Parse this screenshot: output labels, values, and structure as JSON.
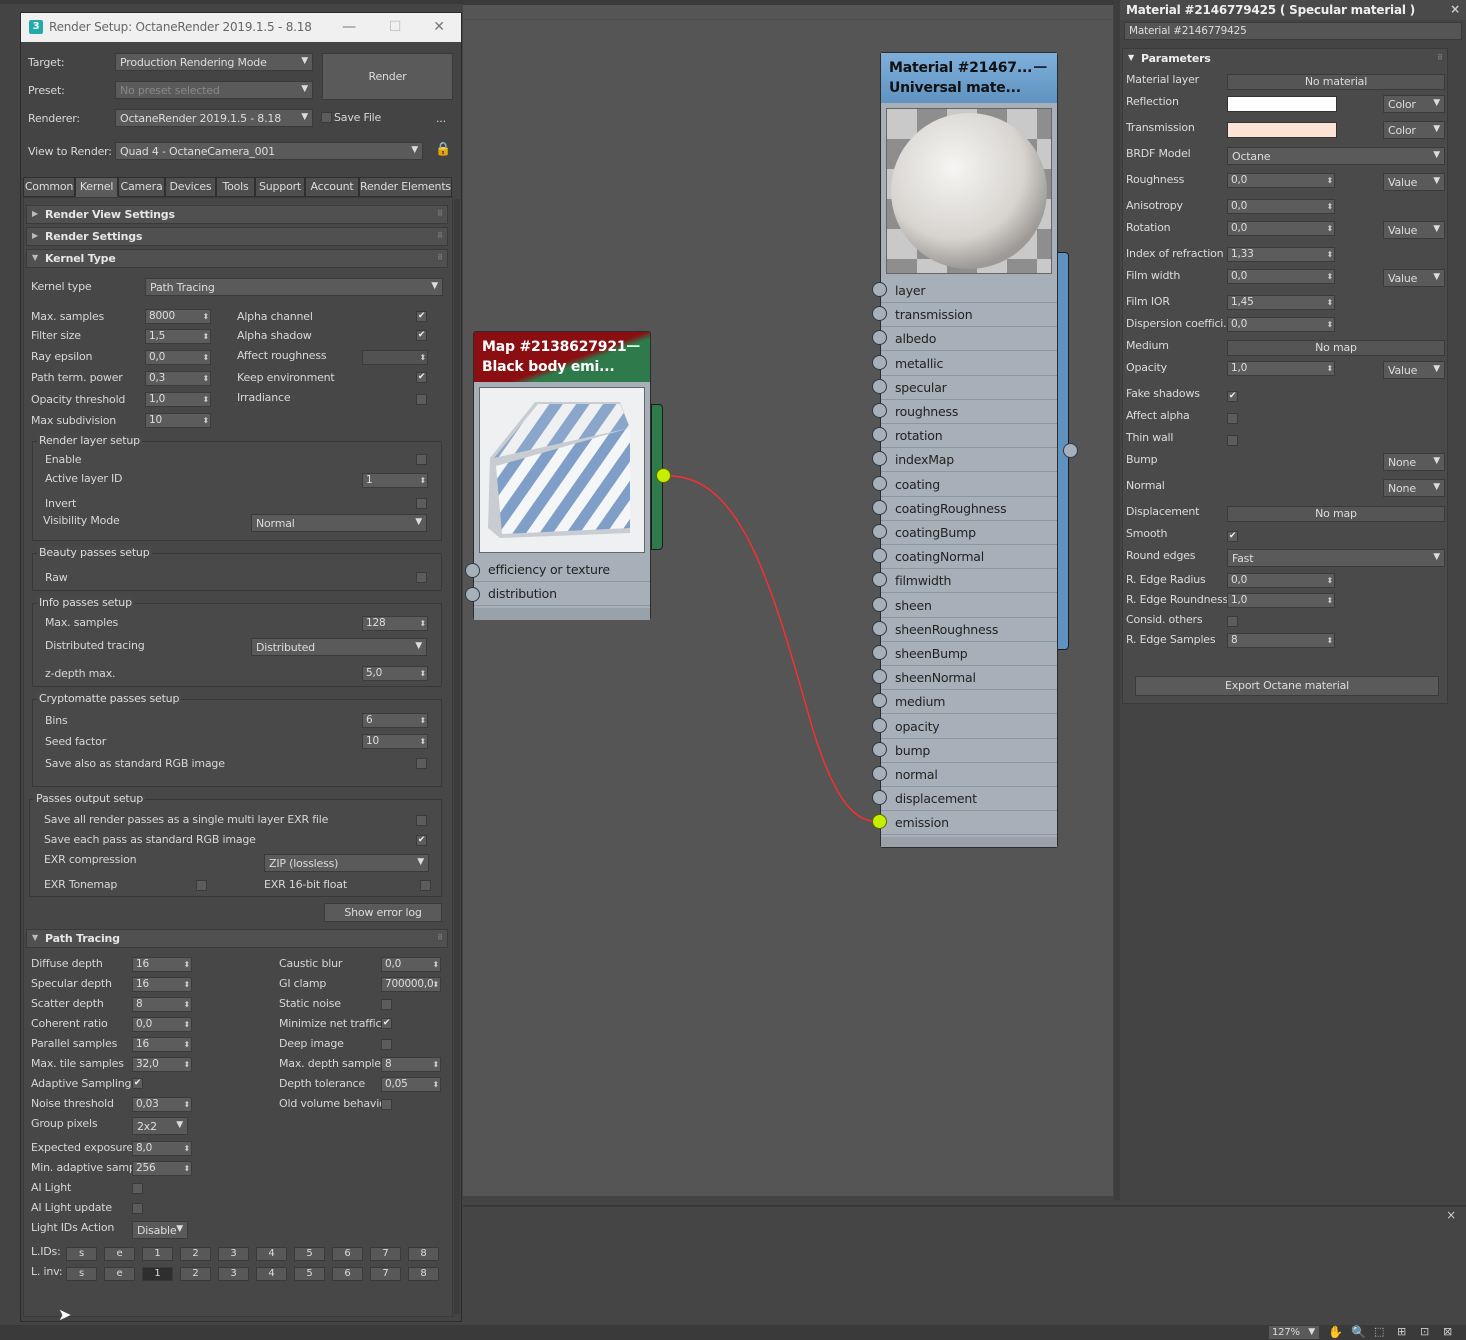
{
  "render_setup": {
    "title": "Render Setup: OctaneRender 2019.1.5 - 8.18",
    "target_label": "Target:",
    "target_value": "Production Rendering Mode",
    "preset_label": "Preset:",
    "preset_value": "No preset selected",
    "renderer_label": "Renderer:",
    "renderer_value": "OctaneRender 2019.1.5 - 8.18",
    "save_file_label": "Save File",
    "dots": "...",
    "view_label": "View to Render:",
    "view_value": "Quad 4 - OctaneCamera_001",
    "render_button": "Render",
    "tabs": [
      "Common",
      "Kernel",
      "Camera",
      "Devices",
      "Tools",
      "Support",
      "Account",
      "Render Elements"
    ],
    "rollouts": {
      "render_view": "Render View Settings",
      "render_settings": "Render Settings",
      "kernel_type": "Kernel Type",
      "path_tracing": "Path Tracing"
    },
    "kernel": {
      "kernel_type_label": "Kernel type",
      "kernel_type_value": "Path Tracing",
      "max_samples_label": "Max. samples",
      "max_samples": "8000",
      "filter_size_label": "Filter size",
      "filter_size": "1,5",
      "ray_epsilon_label": "Ray epsilon",
      "ray_epsilon": "0,0",
      "path_term_label": "Path term. power",
      "path_term": "0,3",
      "opacity_thr_label": "Opacity threshold",
      "opacity_thr": "1,0",
      "max_subdiv_label": "Max subdivision",
      "max_subdiv": "10",
      "alpha_channel": "Alpha channel",
      "alpha_shadow": "Alpha shadow",
      "affect_roughness": "Affect roughness",
      "keep_env": "Keep environment",
      "irradiance": "Irradiance"
    },
    "render_layer": {
      "title": "Render layer setup",
      "enable": "Enable",
      "active_layer_label": "Active layer ID",
      "active_layer": "1",
      "invert": "Invert",
      "visibility_label": "Visibility Mode",
      "visibility_value": "Normal"
    },
    "beauty": {
      "title": "Beauty passes setup",
      "raw": "Raw"
    },
    "info": {
      "title": "Info passes setup",
      "max_samples_label": "Max. samples",
      "max_samples": "128",
      "dist_label": "Distributed tracing",
      "dist_value": "Distributed",
      "zdepth_label": "z-depth max.",
      "zdepth": "5,0"
    },
    "crypto": {
      "title": "Cryptomatte passes setup",
      "bins_label": "Bins",
      "bins": "6",
      "seed_label": "Seed factor",
      "seed": "10",
      "save_rgb": "Save also as standard RGB image"
    },
    "passes_output": {
      "title": "Passes output setup",
      "save_all": "Save all render passes as a single multi layer EXR file",
      "save_each": "Save each pass as standard RGB image",
      "exr_comp_label": "EXR compression",
      "exr_comp_value": "ZIP (lossless)",
      "exr_tonemap": "EXR Tonemap",
      "exr_16bit": "EXR 16-bit float"
    },
    "show_error_log": "Show error log",
    "pt": {
      "diffuse_label": "Diffuse depth",
      "diffuse": "16",
      "specular_label": "Specular depth",
      "specular": "16",
      "scatter_label": "Scatter depth",
      "scatter": "8",
      "coherent_label": "Coherent ratio",
      "coherent": "0,0",
      "parallel_label": "Parallel samples",
      "parallel": "16",
      "tile_label": "Max. tile samples",
      "tile": "32,0",
      "adaptive_label": "Adaptive Sampling",
      "noise_label": "Noise threshold",
      "noise": "0,03",
      "group_label": "Group pixels",
      "group": "2x2",
      "expected_label": "Expected exposure",
      "expected": "8,0",
      "min_adaptive_label": "Min. adaptive sample",
      "min_adaptive": "256",
      "ai_light_label": "AI Light",
      "ai_light_update_label": "AI Light update",
      "light_ids_label": "Light IDs Action",
      "light_ids": "Disable",
      "caustic_label": "Caustic blur",
      "caustic": "0,0",
      "gi_label": "GI clamp",
      "gi": "700000,0",
      "static_noise_label": "Static noise",
      "min_net_label": "Minimize net traffic",
      "deep_image_label": "Deep image",
      "max_depth_label": "Max. depth samples",
      "max_depth": "8",
      "depth_tol_label": "Depth tolerance",
      "depth_tol": "0,05",
      "old_volume_label": "Old volume behavior",
      "lids_label": "L.IDs:",
      "linv_label": "L. inv:",
      "lid_buttons": [
        "s",
        "e",
        "1",
        "2",
        "3",
        "4",
        "5",
        "6",
        "7",
        "8"
      ]
    }
  },
  "nodes": {
    "map": {
      "title1": "Map #2138627921",
      "title2": "Black  body  emi...",
      "slots": [
        "efficiency or texture",
        "distribution"
      ],
      "header_color": "#8b0e12",
      "header_color2": "#2e7a4a"
    },
    "material": {
      "title1": "Material  #21467...",
      "title2": "Universal  mate...",
      "header_color": "#6b9cc6",
      "slots": [
        "layer",
        "transmission",
        "albedo",
        "metallic",
        "specular",
        "roughness",
        "rotation",
        "indexMap",
        "coating",
        "coatingRoughness",
        "coatingBump",
        "coatingNormal",
        "filmwidth",
        "sheen",
        "sheenRoughness",
        "sheenBump",
        "sheenNormal",
        "medium",
        "opacity",
        "bump",
        "normal",
        "displacement",
        "emission"
      ]
    }
  },
  "material_panel": {
    "title": "Material #2146779425  ( Specular material )",
    "name": "Material #2146779425",
    "section": "Parameters",
    "material_layer_label": "Material layer",
    "material_layer": "No material",
    "reflection_label": "Reflection",
    "reflection_color": "#ffffff",
    "transmission_label": "Transmission",
    "transmission_color": "#fde3d4",
    "color_mode": "Color",
    "brdf_label": "BRDF Model",
    "brdf": "Octane",
    "roughness_label": "Roughness",
    "roughness": "0,0",
    "value_mode": "Value",
    "anisotropy_label": "Anisotropy",
    "anisotropy": "0,0",
    "rotation_label": "Rotation",
    "rotation": "0,0",
    "ior_label": "Index of refraction",
    "ior": "1,33",
    "film_width_label": "Film width",
    "film_width": "0,0",
    "film_ior_label": "Film IOR",
    "film_ior": "1,45",
    "dispersion_label": "Dispersion coeffici...",
    "dispersion": "0,0",
    "medium_label": "Medium",
    "medium": "No map",
    "opacity_label": "Opacity",
    "opacity": "1,0",
    "fake_shadows_label": "Fake shadows",
    "affect_alpha_label": "Affect alpha",
    "thin_wall_label": "Thin wall",
    "bump_label": "Bump",
    "bump": "None",
    "normal_label": "Normal",
    "normal": "None",
    "displacement_label": "Displacement",
    "displacement": "No map",
    "smooth_label": "Smooth",
    "round_edges_label": "Round edges",
    "round_edges": "Fast",
    "edge_radius_label": "R. Edge Radius",
    "edge_radius": "0,0",
    "edge_round_label": "R. Edge Roundness",
    "edge_round": "1,0",
    "consid_label": "Consid. others",
    "edge_samples_label": "R. Edge Samples",
    "edge_samples": "8",
    "export_button": "Export Octane material"
  },
  "statusbar": {
    "zoom": "127%"
  }
}
